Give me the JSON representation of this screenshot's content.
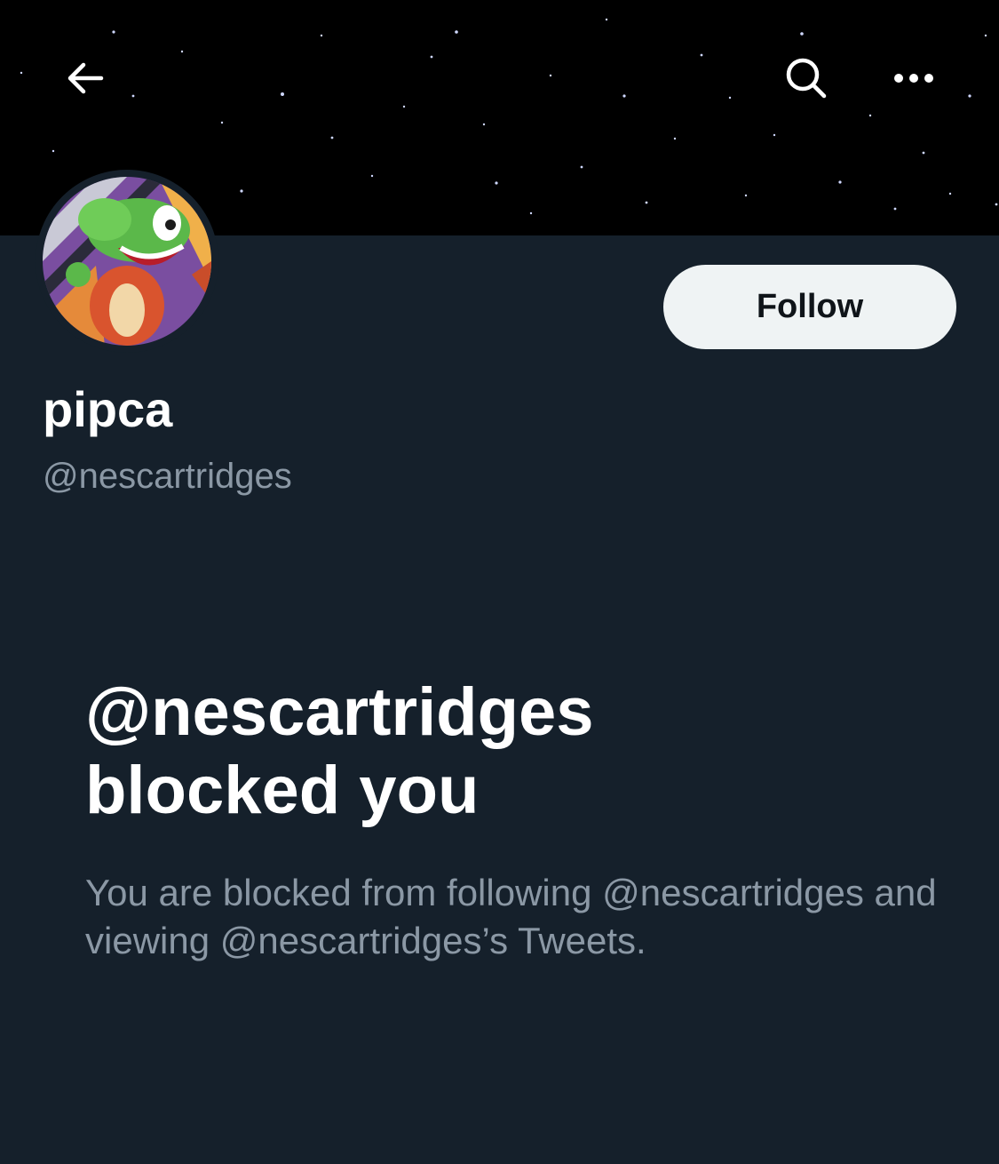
{
  "header": {
    "back_icon": "arrow-left-icon",
    "search_icon": "search-icon",
    "more_icon": "more-horizontal-icon"
  },
  "profile": {
    "display_name": "pipca",
    "handle": "@nescartridges",
    "follow_label": "Follow"
  },
  "blocked": {
    "title_line1": "@nescartridges",
    "title_line2": "blocked you",
    "description": "You are blocked from following @nescartridges and viewing @nescartridges’s Tweets."
  },
  "colors": {
    "background": "#15202b",
    "banner": "#000000",
    "follow_button_bg": "#eff3f4",
    "primary_text": "#ffffff",
    "secondary_text": "#8b98a5"
  }
}
